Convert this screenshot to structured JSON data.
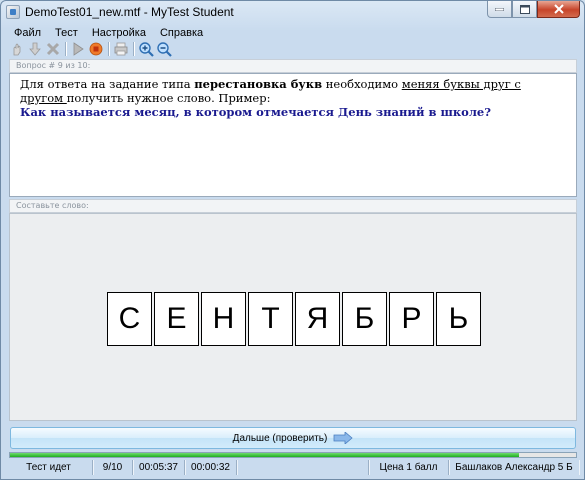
{
  "window": {
    "title": "DemoTest01_new.mtf - MyTest Student"
  },
  "menu": [
    "Файл",
    "Тест",
    "Настройка",
    "Справка"
  ],
  "toolbar": {
    "icons": [
      "hand-icon",
      "down-arrow-icon",
      "x-icon",
      "play-icon",
      "stop-icon",
      "printer-icon",
      "zoom-in-icon",
      "zoom-out-icon"
    ]
  },
  "question": {
    "header": "Вопрос # 9 из 10:",
    "text_1": "Для ответа на задание типа ",
    "text_bold": "перестановка букв",
    "text_2": " необходимо ",
    "text_underline": "меняя буквы друг с другом ",
    "text_3": "получить нужное слово. Пример:",
    "question_line": "Как называется месяц, в котором отмечается День знаний в школе?"
  },
  "word_area": {
    "header": "Составьте слово:",
    "letters": [
      "С",
      "Е",
      "Н",
      "Т",
      "Я",
      "Б",
      "Р",
      "Ь"
    ]
  },
  "next_button": {
    "label": "Дальше (проверить)"
  },
  "progress": {
    "fraction": 0.9
  },
  "status": {
    "state": "Тест идет",
    "question_count": "9/10",
    "elapsed": "00:05:37",
    "question_time": "00:00:32",
    "price": "Цена 1 балл",
    "user": "Башлаков Александр 5 Б"
  },
  "colors": {
    "question_text": "#1a1a8f",
    "progress": "#1fae1f",
    "window_bg": "#c9dbee"
  }
}
